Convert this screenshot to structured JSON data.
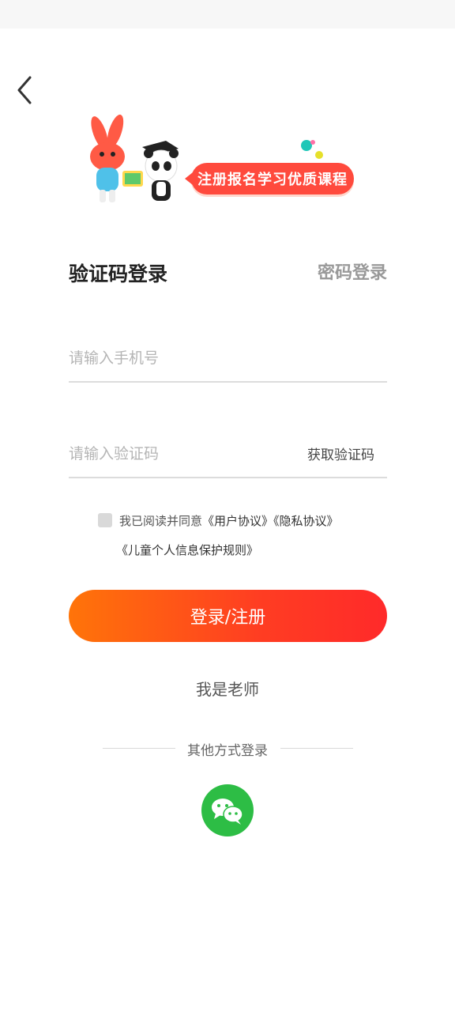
{
  "banner": {
    "slogan": "注册报名学习优质课程"
  },
  "tabs": {
    "sms_login": "验证码登录",
    "password_login": "密码登录"
  },
  "phone_field": {
    "value": "",
    "placeholder": "请输入手机号"
  },
  "code_field": {
    "value": "",
    "placeholder": "请输入验证码",
    "get_code_label": "获取验证码"
  },
  "agreement": {
    "prefix": "我已阅读并同意",
    "user_agreement": "《用户协议》",
    "privacy_agreement": "《隐私协议》",
    "children_rules": "《儿童个人信息保护规则》",
    "checked": false
  },
  "login_button_label": "登录/注册",
  "teacher_link": "我是老师",
  "other_login": {
    "label": "其他方式登录",
    "options": [
      "wechat-icon"
    ]
  },
  "colors": {
    "primary_gradient_start": "#ff7409",
    "primary_gradient_end": "#ff2a2a",
    "bubble_red": "#ff4a3d",
    "wechat_green": "#2dbd45"
  }
}
